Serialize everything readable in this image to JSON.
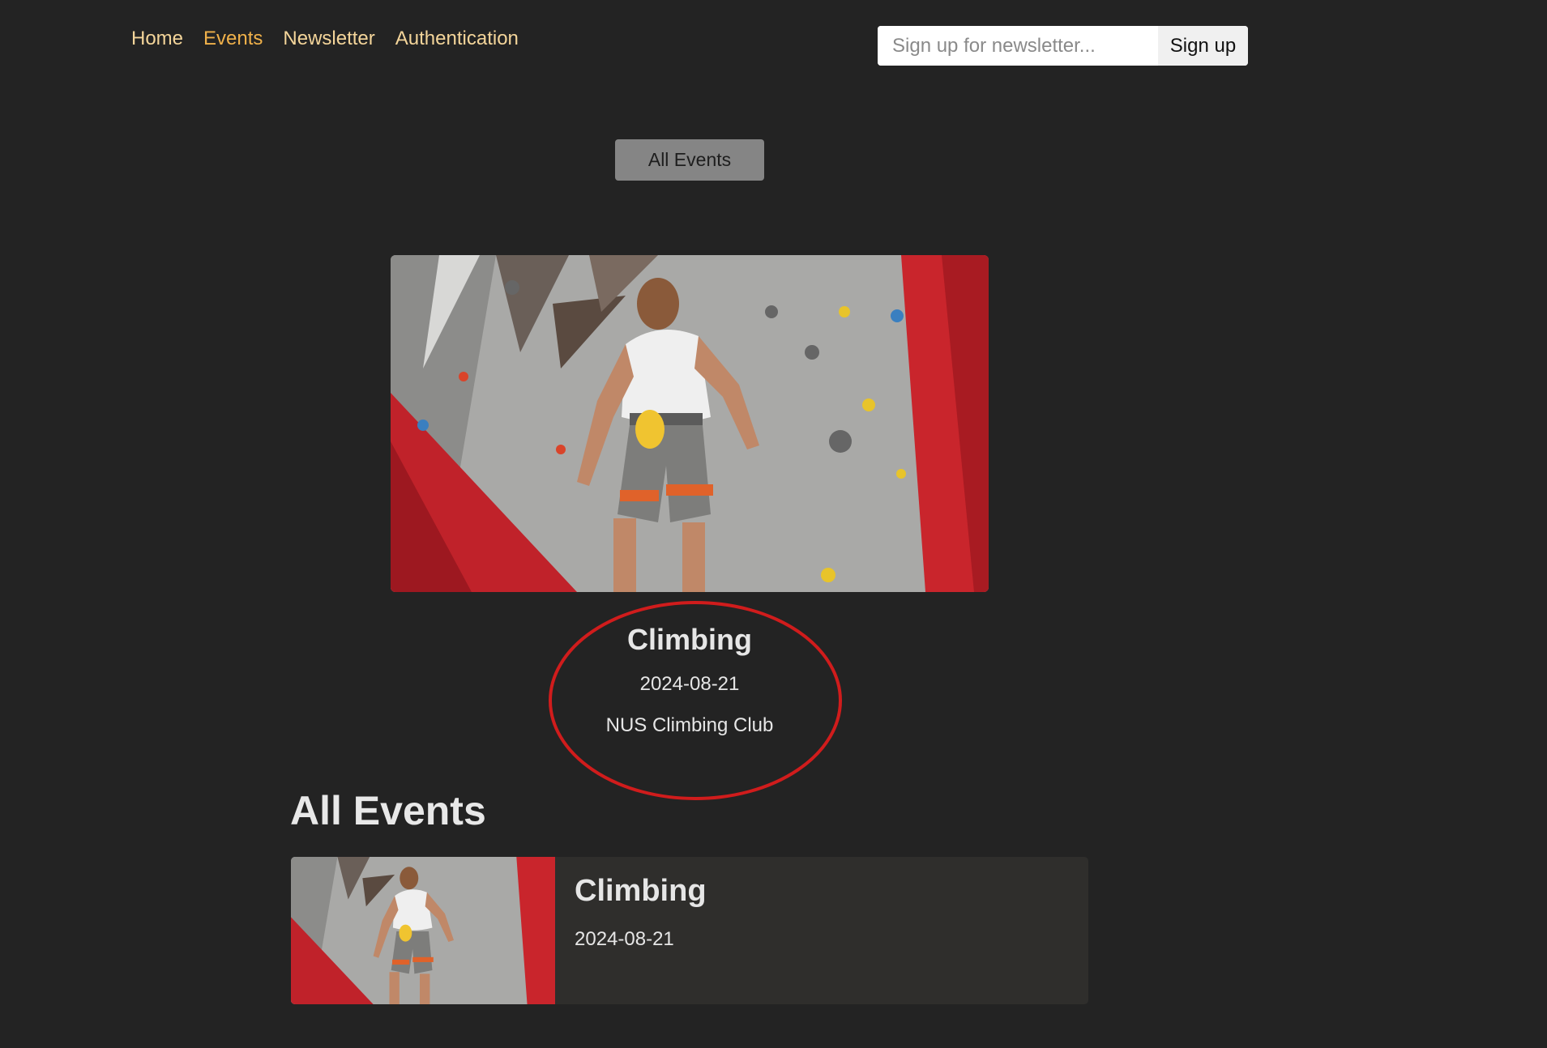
{
  "nav": {
    "items": [
      {
        "label": "Home"
      },
      {
        "label": "Events"
      },
      {
        "label": "Newsletter"
      },
      {
        "label": "Authentication"
      }
    ],
    "active": "Events"
  },
  "newsletter": {
    "placeholder": "Sign up for newsletter...",
    "value": "",
    "button_label": "Sign up"
  },
  "all_events_button": "All Events",
  "featured": {
    "title": "Climbing",
    "date": "2024-08-21",
    "organizer": "NUS Climbing Club",
    "image_icon": "climbing-wall-photo"
  },
  "events_section": {
    "heading": "All Events",
    "events": [
      {
        "title": "Climbing",
        "date": "2024-08-21"
      }
    ]
  },
  "colors": {
    "background": "#232323",
    "nav_link": "#f4d59a",
    "nav_active": "#f0b14a",
    "highlight": "#d01c1c"
  }
}
